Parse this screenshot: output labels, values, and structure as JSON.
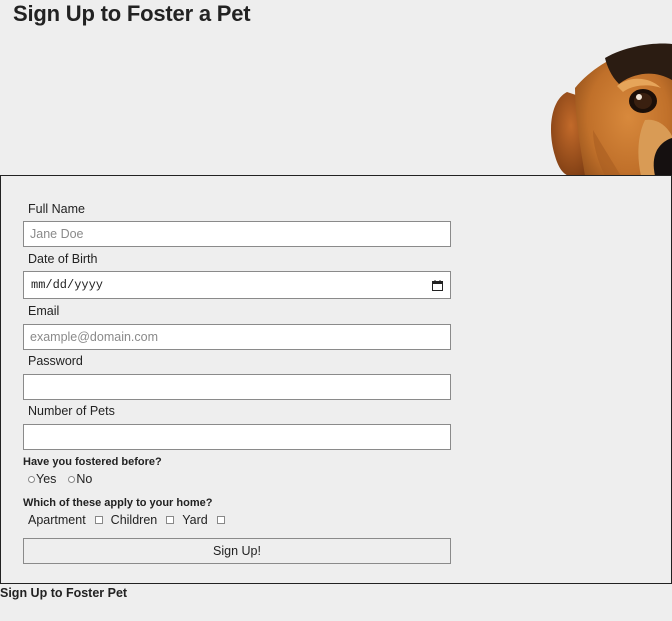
{
  "header": {
    "title": "Sign Up to Foster a Pet",
    "image_icon": "dog-peeking-photo"
  },
  "form": {
    "full_name": {
      "label": "Full Name",
      "placeholder": "Jane Doe",
      "value": ""
    },
    "dob": {
      "label": "Date of Birth",
      "placeholder": "mm/dd/yyyy",
      "icon": "calendar-icon"
    },
    "email": {
      "label": "Email",
      "placeholder": "example@domain.com",
      "value": ""
    },
    "password": {
      "label": "Password",
      "value": ""
    },
    "num_pets": {
      "label": "Number of Pets",
      "value": ""
    },
    "fostered_before": {
      "question": "Have you fostered before?",
      "options": [
        "Yes",
        "No"
      ]
    },
    "home": {
      "question": "Which of these apply to your home?",
      "options": [
        "Apartment",
        "Children",
        "Yard"
      ]
    },
    "submit_label": "Sign Up!"
  },
  "footer": {
    "text": "Sign Up to Foster Pet"
  }
}
